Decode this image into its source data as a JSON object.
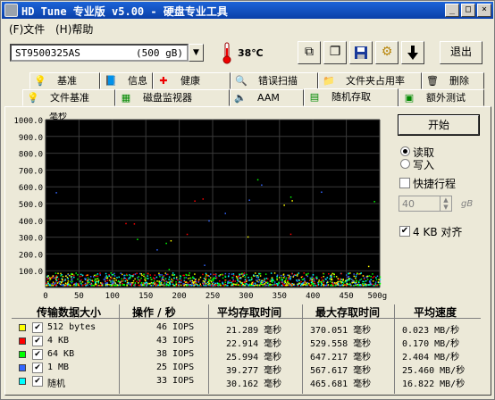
{
  "window": {
    "title": "HD Tune 专业版 v5.00 - 硬盘专业工具",
    "min": "_",
    "max": "□",
    "close": "×"
  },
  "menu": {
    "file": "(F)文件",
    "help": "(H)帮助"
  },
  "toolbar": {
    "drive_name": "ST9500325AS",
    "drive_capacity": "(500 gB)",
    "temperature": "38℃",
    "exit_label": "退出",
    "dropdown_glyph": "▼"
  },
  "tabs_row1": [
    {
      "label": "基准",
      "icon": "benchmark-icon",
      "glyph": "💡"
    },
    {
      "label": "信息",
      "icon": "info-icon",
      "glyph": "📘"
    },
    {
      "label": "健康",
      "icon": "health-icon",
      "glyph": "✚"
    },
    {
      "label": "错误扫描",
      "icon": "error-scan-icon",
      "glyph": "🔍"
    },
    {
      "label": "文件夹占用率",
      "icon": "folder-icon",
      "glyph": "📁"
    },
    {
      "label": "删除",
      "icon": "delete-icon",
      "glyph": "🗑"
    }
  ],
  "tabs_row2": [
    {
      "label": "文件基准",
      "icon": "file-benchmark-icon",
      "glyph": "💡"
    },
    {
      "label": "磁盘监视器",
      "icon": "disk-monitor-icon",
      "glyph": "▦"
    },
    {
      "label": "AAM",
      "icon": "speaker-icon",
      "glyph": "🔈"
    },
    {
      "label": "随机存取",
      "icon": "random-access-icon",
      "glyph": "▤"
    },
    {
      "label": "额外测试",
      "icon": "extra-tests-icon",
      "glyph": "▣"
    }
  ],
  "chart_data": {
    "type": "scatter",
    "title": "",
    "ylabel": "毫秒",
    "xlabel": "",
    "x_ticks": [
      "0",
      "50",
      "100",
      "150",
      "200",
      "250",
      "300",
      "350",
      "400",
      "450",
      "500gB"
    ],
    "y_ticks": [
      "1000.0",
      "900.0",
      "800.0",
      "700.0",
      "600.0",
      "500.0",
      "400.0",
      "300.0",
      "200.0",
      "100.0"
    ],
    "xlim": [
      0,
      500
    ],
    "ylim": [
      0,
      1000
    ],
    "grid": true,
    "background": "#000000",
    "series_colors": [
      "#ffff00",
      "#ff0000",
      "#00ff00",
      "#3366ff",
      "#00ffff"
    ]
  },
  "controls": {
    "start_label": "开始",
    "read_label": "读取",
    "write_label": "写入",
    "short_stroke_label": "快捷行程",
    "short_stroke_value": "40",
    "short_stroke_unit": "gB",
    "align_label": "4 KB 对齐",
    "mode": "read"
  },
  "results": {
    "headers": [
      "传输数据大小",
      "操作 / 秒",
      "平均存取时间",
      "最大存取时间",
      "平均速度"
    ],
    "rows": [
      {
        "name": "512 bytes",
        "color": "#ffff00",
        "ops": "46 IOPS",
        "avg": "21.289 毫秒",
        "max": "370.051 毫秒",
        "speed": "0.023 MB/秒"
      },
      {
        "name": "4 KB",
        "color": "#ff0000",
        "ops": "43 IOPS",
        "avg": "22.914 毫秒",
        "max": "529.558 毫秒",
        "speed": "0.170 MB/秒"
      },
      {
        "name": "64 KB",
        "color": "#00ff00",
        "ops": "38 IOPS",
        "avg": "25.994 毫秒",
        "max": "647.217 毫秒",
        "speed": "2.404 MB/秒"
      },
      {
        "name": "1 MB",
        "color": "#3366ff",
        "ops": "25 IOPS",
        "avg": "39.277 毫秒",
        "max": "567.617 毫秒",
        "speed": "25.460 MB/秒"
      },
      {
        "name": "随机",
        "color": "#00ffff",
        "ops": "33 IOPS",
        "avg": "30.162 毫秒",
        "max": "465.681 毫秒",
        "speed": "16.822 MB/秒"
      }
    ]
  }
}
